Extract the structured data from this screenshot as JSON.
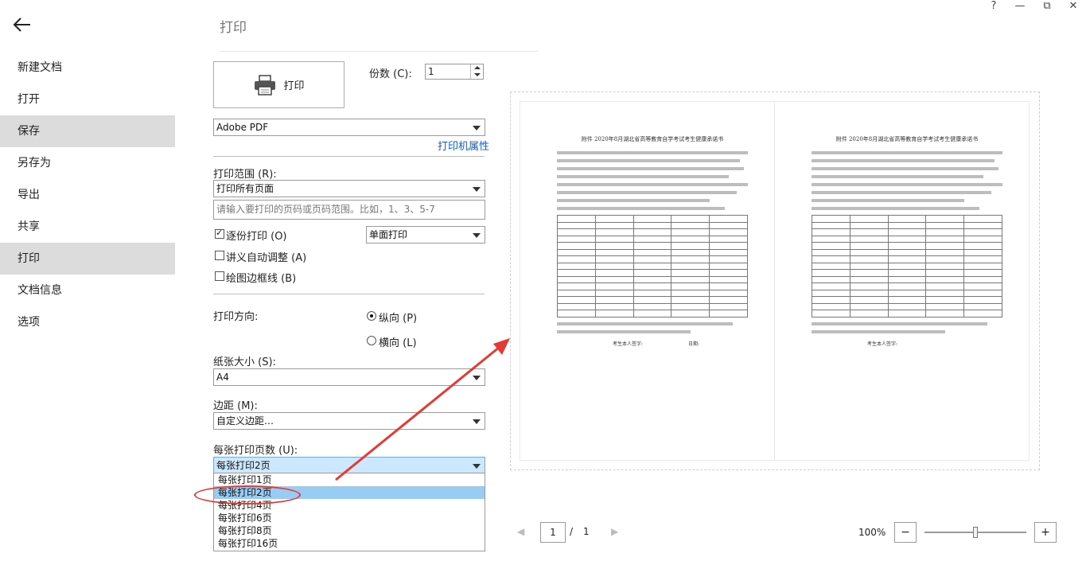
{
  "window": {
    "help": "?",
    "minimize": "—",
    "restore": "⧉",
    "close": "✕"
  },
  "sidebar": {
    "items": [
      {
        "label": "新建文档"
      },
      {
        "label": "打开"
      },
      {
        "label": "保存",
        "selected": true
      },
      {
        "label": "另存为"
      },
      {
        "label": "导出"
      },
      {
        "label": "共享"
      },
      {
        "label": "打印",
        "selected": true
      },
      {
        "label": "文档信息"
      },
      {
        "label": "选项"
      }
    ]
  },
  "main": {
    "title": "打印",
    "print_button": "打印",
    "copies": {
      "label": "份数 (C):",
      "value": "1"
    },
    "printer": {
      "value": "Adobe PDF",
      "properties_link": "打印机属性"
    },
    "range": {
      "label": "打印范围 (R):",
      "value": "打印所有页面",
      "placeholder": "请输入要打印的页码或页码范围。比如，1、3、5-7"
    },
    "collate": {
      "label": "逐份打印 (O)",
      "checked": true
    },
    "duplex": {
      "value": "单面打印"
    },
    "handout_adjust": {
      "label": "讲义自动调整 (A)",
      "checked": false
    },
    "draw_border": {
      "label": "绘图边框线 (B)",
      "checked": false
    },
    "orientation": {
      "label": "打印方向:",
      "portrait": "纵向 (P)",
      "landscape": "横向 (L)",
      "selected": "portrait"
    },
    "paper_size": {
      "label": "纸张大小 (S):",
      "value": "A4"
    },
    "margins": {
      "label": "边距 (M):",
      "value": "自定义边距…"
    },
    "pages_per_sheet": {
      "label": "每张打印页数 (U):",
      "value": "每张打印2页",
      "options": [
        "每张打印1页",
        "每张打印2页",
        "每张打印4页",
        "每张打印6页",
        "每张打印8页",
        "每张打印16页"
      ],
      "selected_index": 1
    }
  },
  "preview": {
    "doc_title": "附件  2020年8月湖北省高等教育自学考试考生健康承诺书",
    "signature": "考生本人签字:",
    "date_label": "日期:",
    "current_page": "1",
    "separator": "/",
    "total_pages": "1",
    "zoom": "100%",
    "zoom_out": "−",
    "zoom_in": "+"
  },
  "colors": {
    "selected_nav": "#dcdcdc",
    "link": "#1a5fb4",
    "annotation": "#e53935",
    "dropdown_highlight": "#99ccf2"
  }
}
